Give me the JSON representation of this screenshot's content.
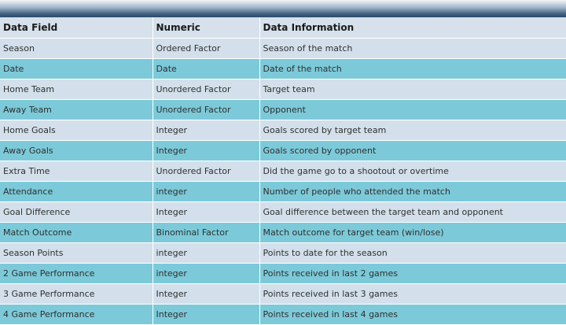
{
  "table": {
    "headers": [
      "Data Field",
      "Numeric",
      "Data Information"
    ],
    "rows": [
      [
        "Season",
        "Ordered Factor",
        "Season of the match"
      ],
      [
        "Date",
        "Date",
        "Date of the match"
      ],
      [
        "Home Team",
        "Unordered Factor",
        "Target team"
      ],
      [
        "Away Team",
        "Unordered Factor",
        "Opponent"
      ],
      [
        "Home Goals",
        "Integer",
        "Goals scored by target team"
      ],
      [
        "Away Goals",
        "Integer",
        "Goals scored by opponent"
      ],
      [
        "Extra Time",
        "Unordered Factor",
        "Did the game go to a shootout or overtime"
      ],
      [
        "Attendance",
        "integer",
        "Number of people who attended the match"
      ],
      [
        "Goal Difference",
        "Integer",
        "Goal difference between the target team and opponent"
      ],
      [
        "Match Outcome",
        "Binominal Factor",
        "Match outcome for target team (win/lose)"
      ],
      [
        "Season Points",
        "integer",
        "Points to date for the season"
      ],
      [
        "2 Game Performance",
        "integer",
        "Points received in last 2 games"
      ],
      [
        "3 Game Performance",
        "Integer",
        "Points received in last 3 games"
      ],
      [
        "4 Game Performance",
        "Integer",
        "Points received in last 4 games"
      ]
    ]
  },
  "colors": {
    "row_light": "#d3e0eb",
    "row_teal": "#7ccad9",
    "header_bar": "#2c4b6c"
  }
}
